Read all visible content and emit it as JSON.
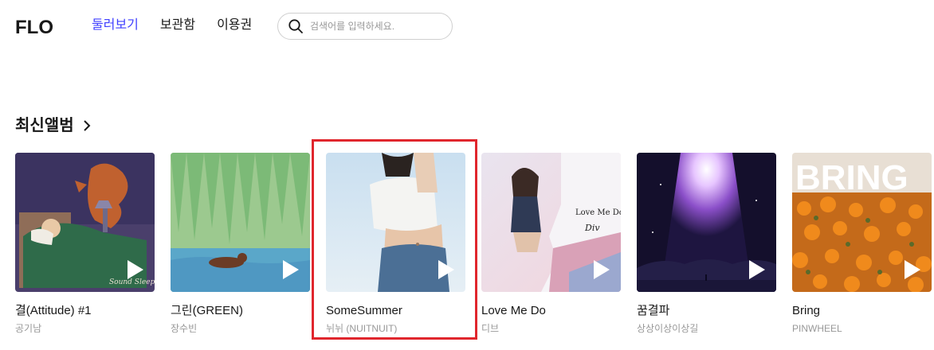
{
  "header": {
    "logo": "FLO",
    "nav": [
      {
        "label": "둘러보기",
        "active": true
      },
      {
        "label": "보관함",
        "active": false
      },
      {
        "label": "이용권",
        "active": false
      }
    ],
    "search": {
      "placeholder": "검색어를 입력하세요."
    }
  },
  "section": {
    "title": "최신앨범",
    "albums": [
      {
        "title": "결(Attitude) #1",
        "artist": "공기남",
        "cover_text": "Sound Sleep"
      },
      {
        "title": "그린(GREEN)",
        "artist": "장수빈"
      },
      {
        "title": "SomeSummer",
        "artist": "뉘뉘 (NUITNUIT)",
        "highlighted": true
      },
      {
        "title": "Love Me Do",
        "artist": "디브",
        "cover_text": "Love Me Do",
        "cover_text_2": "Div"
      },
      {
        "title": "꿈결파",
        "artist": "상상이상이상길"
      },
      {
        "title": "Bring",
        "artist": "PINWHEEL",
        "cover_text": "BRING"
      }
    ]
  },
  "colors": {
    "accent": "#3f3fff",
    "highlight_border": "#e0262d"
  }
}
